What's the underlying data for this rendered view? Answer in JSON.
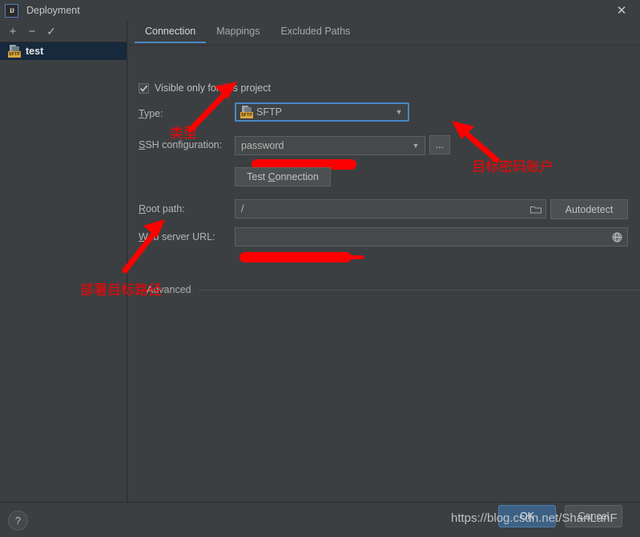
{
  "window": {
    "title": "Deployment",
    "logo_text": "IJ",
    "close_icon": "close-icon"
  },
  "sidebar": {
    "toolbar": [
      {
        "name": "add-button",
        "glyph": "+"
      },
      {
        "name": "remove-button",
        "glyph": "−"
      },
      {
        "name": "set-default-button",
        "glyph": "✓"
      }
    ],
    "items": [
      {
        "label": "test",
        "icon": "sftp-icon",
        "badge": "SFTP",
        "selected": true
      }
    ]
  },
  "main": {
    "tabs": [
      {
        "label": "Connection",
        "active": true
      },
      {
        "label": "Mappings",
        "active": false
      },
      {
        "label": "Excluded Paths",
        "active": false
      }
    ],
    "visible_only": {
      "label": "Visible only for this project",
      "checked": true
    },
    "type": {
      "label": "Type:",
      "label_mnemonic": "T",
      "value": "SFTP",
      "icon": "sftp-icon",
      "badge": "SFTP",
      "focused": true
    },
    "ssh_configuration": {
      "label": "SSH configuration:",
      "label_mnemonic": "S",
      "value": "password",
      "redacted": true,
      "browse_button": "..."
    },
    "test_connection": {
      "label": "Test Connection",
      "mnemonic": "C"
    },
    "root_path": {
      "label": "Root path:",
      "label_mnemonic": "R",
      "value": "/",
      "browse_icon": "folder-icon",
      "autodetect_label": "Autodetect"
    },
    "web_server_url": {
      "label": "Web server URL:",
      "label_mnemonic": "W",
      "value": "",
      "redacted": true,
      "open_icon": "globe-icon"
    },
    "advanced": {
      "label": "Advanced"
    }
  },
  "bottom": {
    "help_label": "?",
    "ok_label": "OK",
    "cancel_label": "Cancel",
    "watermark": "https://blog.csdn.net/ShanLanF"
  },
  "annotations": [
    {
      "name": "annotation-type",
      "text": "类型"
    },
    {
      "name": "annotation-target-password-account",
      "text": "目标密码账户"
    },
    {
      "name": "annotation-deploy-target-path",
      "text": "部署目标路径"
    }
  ],
  "colors": {
    "background": "#3c3f41",
    "selection": "#16293d",
    "accent": "#4a88c7",
    "annotation": "#fe0000",
    "field": "#45494a",
    "ok_button": "#3d6185"
  }
}
